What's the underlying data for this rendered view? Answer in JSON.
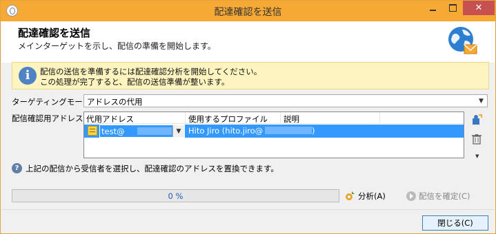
{
  "window": {
    "title": "配達確認を送信",
    "accent_color": "#f7a935"
  },
  "header": {
    "title": "配達確認を送信",
    "subtitle": "メインターゲットを示し、配信の準備を開始します。",
    "icon": "globe-mail-icon"
  },
  "info": {
    "line1": "配信の送信を準備するには配達確認分析を開始してください。",
    "line2": "この処理が完了すると、配信の送信準備が整います。"
  },
  "targeting": {
    "label": "ターゲティングモード:",
    "value": "アドレスの代用"
  },
  "addresses": {
    "label": "配信確認用アドレス:",
    "columns": [
      "代用アドレス",
      "使用するプロファイル",
      "説明"
    ],
    "rows": [
      {
        "address": "test@",
        "profile": "Hito Jiro (hito.jiro@",
        "profile_suffix": ")",
        "description": ""
      }
    ]
  },
  "help_text": "上記の配信から受信者を選択し、配達確認のアドレスを置換できます。",
  "progress": {
    "value": 0,
    "label": "0 %"
  },
  "buttons": {
    "analyze": "分析(A)",
    "confirm": "配信を確定(C)",
    "close": "閉じる(C)"
  }
}
